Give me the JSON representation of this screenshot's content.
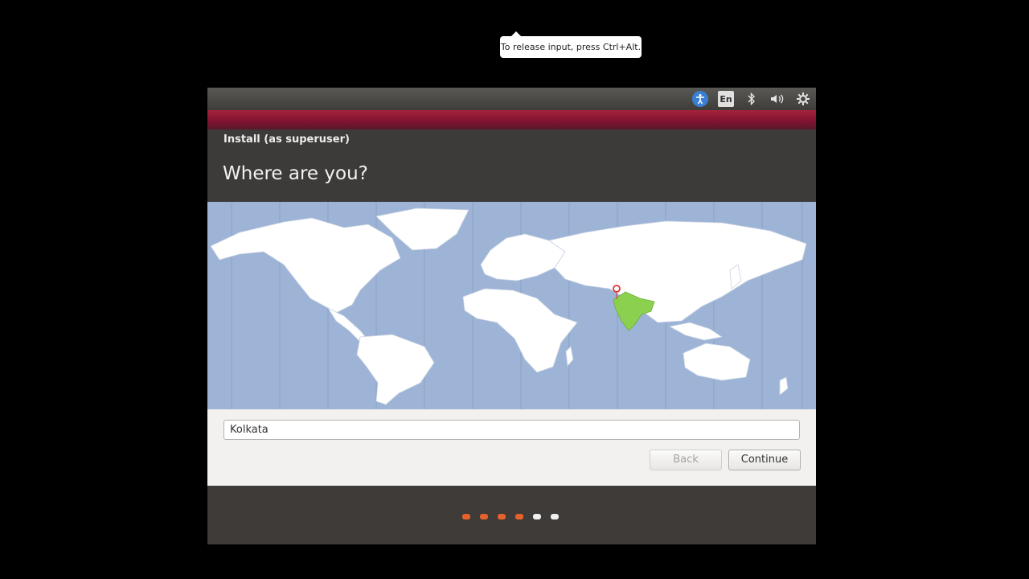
{
  "tooltip": {
    "text": "To release input, press Ctrl+Alt."
  },
  "panel": {
    "language": "En"
  },
  "installer": {
    "window_title": "Install (as superuser)",
    "heading": "Where are you?",
    "timezone": {
      "value": "Kolkata"
    },
    "buttons": {
      "back": "Back",
      "continue": "Continue"
    },
    "progress": {
      "current_step": 4,
      "total_steps": 6
    }
  },
  "map": {
    "highlighted_region": "India",
    "marker_city": "Kolkata"
  },
  "colors": {
    "accent": "#e7622a",
    "highlight": "#8bd14f",
    "ocean": "#9db4d6",
    "titlebar": "#7e1430"
  },
  "icons": [
    "accessibility-icon",
    "keyboard-layout-icon",
    "bluetooth-icon",
    "volume-icon",
    "settings-icon"
  ]
}
